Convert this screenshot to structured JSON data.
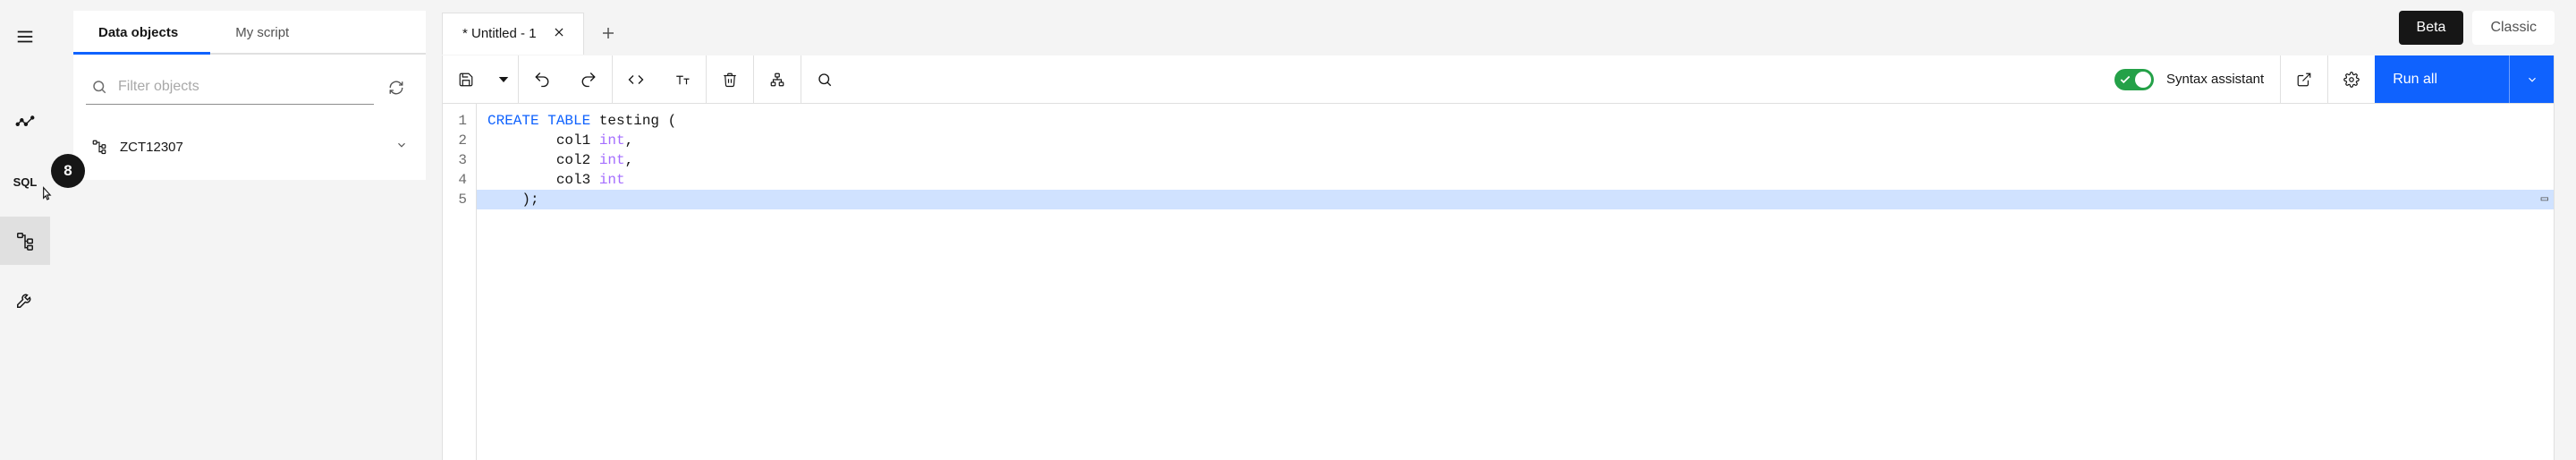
{
  "rail": {
    "sql_label": "SQL"
  },
  "sidepanel": {
    "tabs": {
      "data_objects": "Data objects",
      "my_script": "My script"
    },
    "filter_placeholder": "Filter objects",
    "tree": {
      "root": "ZCT12307"
    }
  },
  "editor_tabs": {
    "tab1": "* Untitled - 1"
  },
  "chips": {
    "beta": "Beta",
    "classic": "Classic"
  },
  "toolbar": {
    "syntax_label": "Syntax assistant",
    "run_all": "Run all"
  },
  "editor": {
    "gutter": [
      "1",
      "2",
      "3",
      "4",
      "5"
    ],
    "lines": [
      {
        "kw": "CREATE TABLE",
        "rest": " testing ("
      },
      {
        "indent": "        ",
        "id": "col1 ",
        "tp": "int",
        "rest": ","
      },
      {
        "indent": "        ",
        "id": "col2 ",
        "tp": "int",
        "rest": ","
      },
      {
        "indent": "        ",
        "id": "col3 ",
        "tp": "int",
        "rest": ""
      },
      {
        "indent": "    ",
        "id": ");",
        "tp": "",
        "rest": ""
      }
    ]
  },
  "step_badge": "8"
}
